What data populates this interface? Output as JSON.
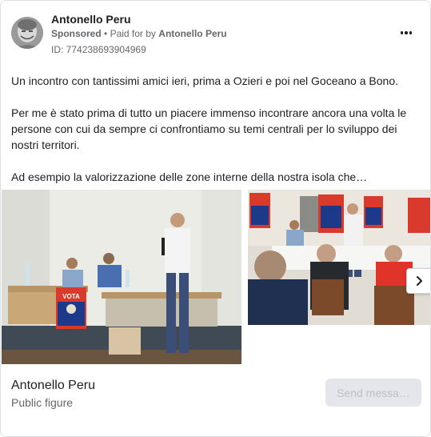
{
  "header": {
    "advertiser_name": "Antonello Peru",
    "sponsored_label": "Sponsored",
    "separator": "•",
    "paid_for_prefix": "Paid for by",
    "paid_for_name": "Antonello Peru",
    "library_id": "ID: 774238693904969"
  },
  "body": {
    "paragraphs": [
      "Un incontro con tantissimi amici ieri, prima a Ozieri e poi nel Goceano a Bono.",
      "Per me è stato prima di tutto un piacere immenso incontrare ancora una volta le persone con cui da sempre ci confrontiamo su temi centrali per lo sviluppo dei nostri territori.",
      "Ad esempio la valorizzazione delle zone interne della nostra isola che…"
    ]
  },
  "carousel": {
    "banner_text": "VOTA"
  },
  "footer": {
    "page_name": "Antonello Peru",
    "page_category": "Public figure",
    "send_button_label": "Send messa…"
  },
  "colors": {
    "text_primary": "#1c1e21",
    "text_secondary": "#65676b",
    "button_disabled_bg": "#e4e6eb",
    "button_disabled_text": "#bcc0c4",
    "banner_blue": "#1d3a8a",
    "banner_red": "#d93a2b"
  },
  "icons": {
    "more": "more-horizontal-icon",
    "next": "chevron-right-icon"
  }
}
